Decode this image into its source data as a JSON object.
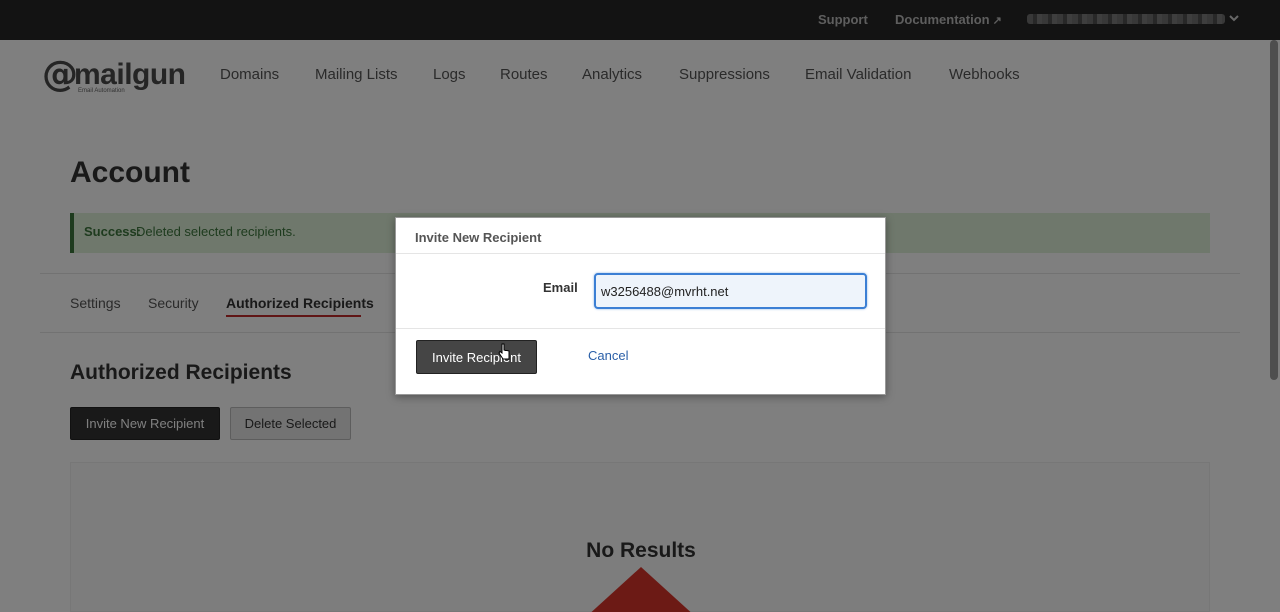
{
  "topbar": {
    "support": "Support",
    "documentation": "Documentation",
    "external_icon": "external-link-icon"
  },
  "logo": {
    "at": "@",
    "name": "mailgun",
    "tagline": "Email Automation"
  },
  "nav": {
    "items": [
      {
        "label": "Domains"
      },
      {
        "label": "Mailing Lists"
      },
      {
        "label": "Logs"
      },
      {
        "label": "Routes"
      },
      {
        "label": "Analytics"
      },
      {
        "label": "Suppressions"
      },
      {
        "label": "Email Validation"
      },
      {
        "label": "Webhooks"
      }
    ]
  },
  "page": {
    "title": "Account",
    "alert": {
      "strong": "Success:",
      "message": "Deleted selected recipients."
    },
    "tabs": [
      {
        "label": "Settings"
      },
      {
        "label": "Security"
      },
      {
        "label": "Authorized Recipients",
        "active": true
      }
    ],
    "section_title": "Authorized Recipients",
    "invite_button": "Invite New Recipient",
    "delete_button": "Delete Selected",
    "empty_text": "No Results"
  },
  "modal": {
    "title": "Invite New Recipient",
    "email_label": "Email",
    "email_value": "w3256488@mvrht.net",
    "invite_button": "Invite Recipient",
    "cancel": "Cancel"
  },
  "colors": {
    "topbar": "#262626",
    "accent_red": "#c02b2b",
    "success_bg": "#dff0d8",
    "success_text": "#3c763d",
    "link": "#2a5fa8",
    "focus": "#3b7fd4"
  }
}
